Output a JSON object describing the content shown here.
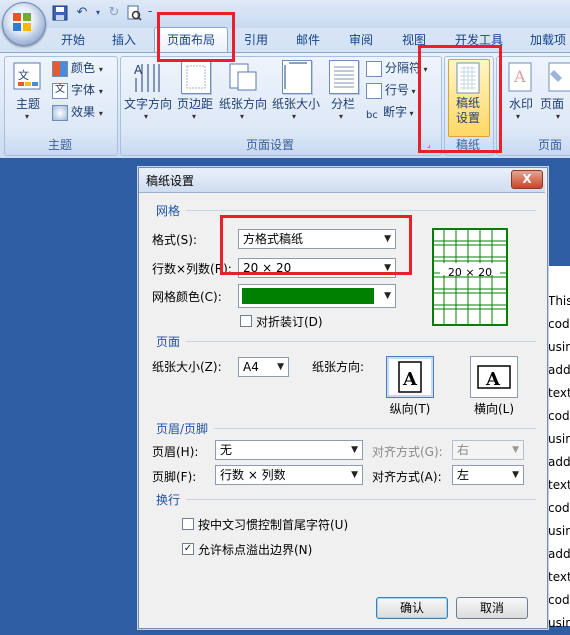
{
  "qat": {
    "undo_icon": "undo-icon",
    "redo_icon": "redo-icon",
    "save_icon": "save-icon",
    "customize": "‐"
  },
  "tabs": [
    "开始",
    "插入",
    "页面布局",
    "引用",
    "邮件",
    "审阅",
    "视图",
    "开发工具",
    "加载项"
  ],
  "active_tab": "页面布局",
  "ribbon": {
    "theme_group": {
      "label": "主题",
      "themes": "主题",
      "colors": "颜色",
      "fonts": "字体",
      "effects": "效果"
    },
    "page_setup_group": {
      "label": "页面设置",
      "text_direction": "文字方向",
      "margins": "页边距",
      "orientation": "纸张方向",
      "size": "纸张大小",
      "columns": "分栏",
      "breaks": "分隔符",
      "line_numbers": "行号",
      "hyphenation": "断字"
    },
    "manuscript_group": {
      "label": "稿纸",
      "settings": "稿纸\n设置",
      "settings_l1": "稿纸",
      "settings_l2": "设置"
    },
    "page_bg_group": {
      "label": "页面",
      "watermark": "水印",
      "page_color": "页面"
    }
  },
  "document_lines": [
    "This",
    "cod",
    "usin",
    "add",
    "text",
    "cod",
    "usin",
    "add",
    "text",
    "cod",
    "usin",
    "add",
    "text",
    "cod",
    "usin"
  ],
  "dialog": {
    "title": "稿纸设置",
    "close": "X",
    "grid_section": "网格",
    "style_label": "格式(S):",
    "style_value": "方格式稿纸",
    "rows_cols_label": "行数×列数(R):",
    "rows_cols_value": "20 × 20",
    "grid_color_label": "网格颜色(C):",
    "grid_color_value": "#008000",
    "fold_binding": "对折装订(D)",
    "preview_text": "20 × 20",
    "page_section": "页面",
    "paper_size_label": "纸张大小(Z):",
    "paper_size_value": "A4",
    "orientation_label": "纸张方向:",
    "portrait_label": "纵向(T)",
    "landscape_label": "横向(L)",
    "header_footer_section": "页眉/页脚",
    "header_label": "页眉(H):",
    "header_value": "无",
    "header_align_label": "对齐方式(G):",
    "header_align_value": "右",
    "footer_label": "页脚(F):",
    "footer_value": "行数 × 列数",
    "footer_align_label": "对齐方式(A):",
    "footer_align_value": "左",
    "line_break_section": "换行",
    "chk_cjk_rules": "按中文习惯控制首尾字符(U)",
    "chk_cjk_rules_checked": false,
    "chk_allow_overflow": "允许标点溢出边界(N)",
    "chk_allow_overflow_checked": true,
    "ok": "确认",
    "cancel": "取消"
  },
  "colors": {
    "highlight": "#e8202a",
    "grid_green": "#008000",
    "ribbon_blue": "#15428b",
    "doc_bg": "#2f5da3"
  }
}
